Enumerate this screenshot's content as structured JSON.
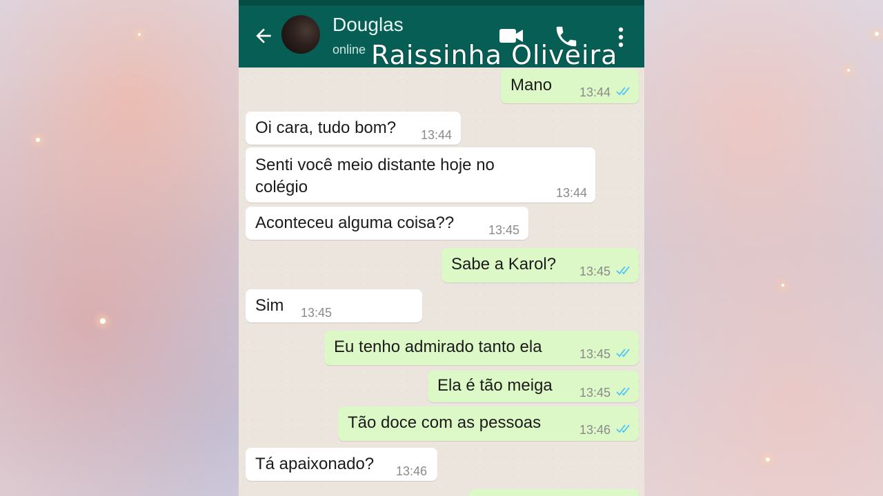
{
  "chat": {
    "contact_name": "Douglas",
    "status": "online",
    "watermark": "Raissinha Oliveira"
  },
  "header_icons": [
    "back-arrow-icon",
    "video-call-icon",
    "phone-icon",
    "more-options-icon"
  ],
  "colors": {
    "header": "#075e54",
    "outgoing_bubble": "#dcf8c6",
    "incoming_bubble": "#ffffff",
    "read_ticks": "#4fc3f7",
    "chat_background": "#ece5dd"
  },
  "messages": [
    {
      "direction": "out",
      "text": "Mano",
      "time": "13:44",
      "read": true
    },
    {
      "direction": "in",
      "text": "Oi cara, tudo bom?",
      "time": "13:44"
    },
    {
      "direction": "in",
      "text": "Senti você meio distante hoje no colégio",
      "time": "13:44"
    },
    {
      "direction": "in",
      "text": "Aconteceu alguma coisa??",
      "time": "13:45"
    },
    {
      "direction": "out",
      "text": "Sabe a Karol?",
      "time": "13:45",
      "read": true
    },
    {
      "direction": "in",
      "text": "Sim",
      "time": "13:45"
    },
    {
      "direction": "out",
      "text": "Eu tenho admirado tanto ela",
      "time": "13:45",
      "read": true
    },
    {
      "direction": "out",
      "text": "Ela é tão meiga",
      "time": "13:45",
      "read": true
    },
    {
      "direction": "out",
      "text": "Tão doce com as pessoas",
      "time": "13:46",
      "read": true
    },
    {
      "direction": "in",
      "text": "Tá apaixonado?",
      "time": "13:46"
    }
  ]
}
